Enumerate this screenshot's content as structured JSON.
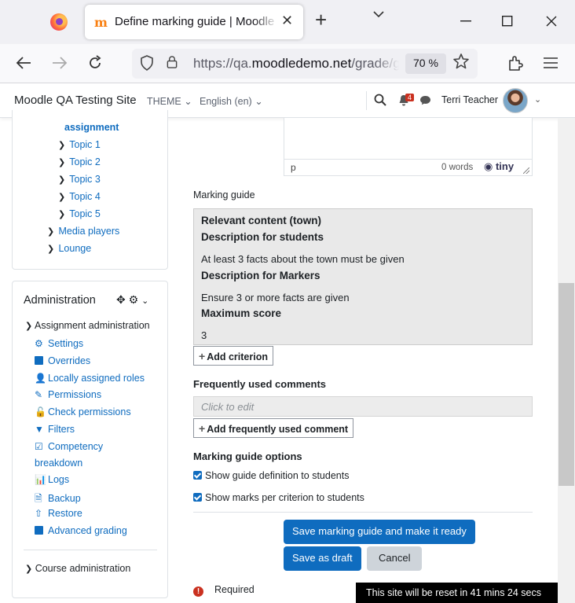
{
  "browser": {
    "tab_title": "Define marking guide | Moodle QA Testing Site",
    "tab_close": "✕",
    "new_tab": "+",
    "url_scheme": "https://qa.",
    "url_domain": "moodledemo.net",
    "url_path": "/grade/grading/form/guide/edit.php",
    "zoom": "70 %"
  },
  "navbar": {
    "site_name": "Moodle QA Testing Site",
    "theme_label": "THEME",
    "language_label": "English (en)",
    "notification_count": "4",
    "user_name": "Terri Teacher"
  },
  "course_tree": {
    "current": "assignment",
    "topics": [
      "Topic 1",
      "Topic 2",
      "Topic 3",
      "Topic 4",
      "Topic 5"
    ],
    "media_players": "Media players",
    "lounge": "Lounge"
  },
  "admin_block": {
    "title": "Administration",
    "section": "Assignment administration",
    "links": [
      {
        "label": "Settings",
        "icon": "gear-icon"
      },
      {
        "label": "Overrides",
        "icon": "square-icon"
      },
      {
        "label": "Locally assigned roles",
        "icon": "user-icon"
      },
      {
        "label": "Permissions",
        "icon": "edit-icon"
      },
      {
        "label": "Check permissions",
        "icon": "unlock-icon"
      },
      {
        "label": "Filters",
        "icon": "filter-icon"
      },
      {
        "label": "Competency",
        "label2": "breakdown",
        "icon": "checkbox-icon"
      },
      {
        "label": "Logs",
        "icon": "chart-icon"
      },
      {
        "label": "Backup",
        "icon": "file-icon"
      },
      {
        "label": "Restore",
        "icon": "upload-icon"
      },
      {
        "label": "Advanced grading",
        "icon": "square-icon"
      }
    ],
    "course_admin": "Course administration"
  },
  "editor": {
    "path_label": "p",
    "word_count": "0 words",
    "brand": "tiny"
  },
  "marking_guide": {
    "label": "Marking guide",
    "criterion_name": "Relevant content (town)",
    "desc_students_label": "Description for students",
    "desc_students": "At least 3 facts about the town must be given",
    "desc_markers_label": "Description for Markers",
    "desc_markers": "Ensure 3 or more facts are given",
    "max_score_label": "Maximum score",
    "max_score": "3",
    "add_criterion": "Add criterion"
  },
  "comments": {
    "label": "Frequently used comments",
    "placeholder": "Click to edit",
    "add_button": "Add frequently used comment"
  },
  "options": {
    "label": "Marking guide options",
    "show_definition": "Show guide definition to students",
    "show_marks": "Show marks per criterion to students"
  },
  "actions": {
    "save_ready": "Save marking guide and make it ready",
    "save_draft": "Save as draft",
    "cancel": "Cancel"
  },
  "required_label": "Required",
  "reset_notice": "This site will be reset in 41 mins 24 secs",
  "colors": {
    "primary": "#0f6cbf",
    "secondary": "#ced4da",
    "danger": "#ca3120",
    "guide_bg": "#e9e9e9"
  }
}
